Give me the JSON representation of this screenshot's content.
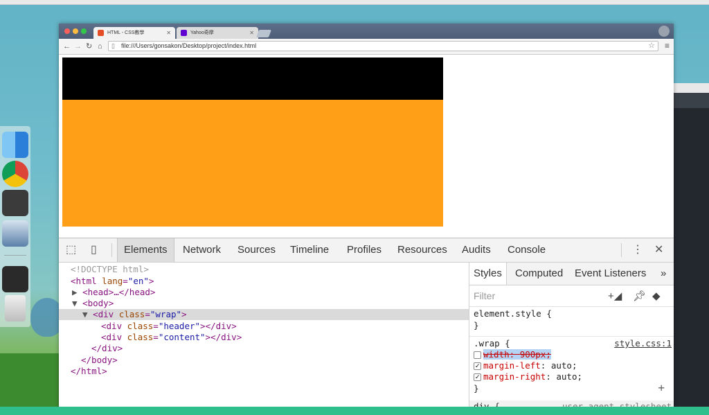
{
  "browser": {
    "tabs": [
      {
        "label": "HTML - CSS教學",
        "favicon_color": "#e44d26"
      },
      {
        "label": "Yahoo奇摩",
        "favicon_color": "#6001d2"
      }
    ],
    "url": "file:///Users/gonsakon/Desktop/project/index.html"
  },
  "page": {
    "header_color": "#000000",
    "content_color": "#ff9e17"
  },
  "devtools": {
    "tabs": [
      "Elements",
      "Network",
      "Sources",
      "Timeline",
      "Profiles",
      "Resources",
      "Audits",
      "Console"
    ],
    "selected_tab": "Elements",
    "dom": {
      "doctype": "<!DOCTYPE html>",
      "html_open_tag": "<html",
      "html_lang_attr": "lang",
      "html_lang_value": "\"en\"",
      "head_collapsed": "<head>…</head>",
      "body_open": "<body>",
      "div_open": "<div",
      "class_attr": "class",
      "wrap_value": "\"wrap\"",
      "header_value": "\"header\"",
      "content_value": "\"content\"",
      "div_close": "</div>",
      "body_close": "</body>",
      "html_close": "</html>"
    },
    "sidebar": {
      "tabs": [
        "Styles",
        "Computed",
        "Event Listeners"
      ],
      "filter_placeholder": "Filter",
      "element_style_selector": "element.style {",
      "close_brace": "}",
      "wrap_selector": ".wrap {",
      "wrap_source": "style.css:1",
      "declarations": [
        {
          "property": "width",
          "value": "900px",
          "checked": false,
          "struck": true
        },
        {
          "property": "margin-left",
          "value": "auto",
          "checked": true,
          "struck": false
        },
        {
          "property": "margin-right",
          "value": "auto",
          "checked": true,
          "struck": false
        }
      ],
      "ua_selector": "div {",
      "ua_source": "user agent stylesheet"
    }
  }
}
